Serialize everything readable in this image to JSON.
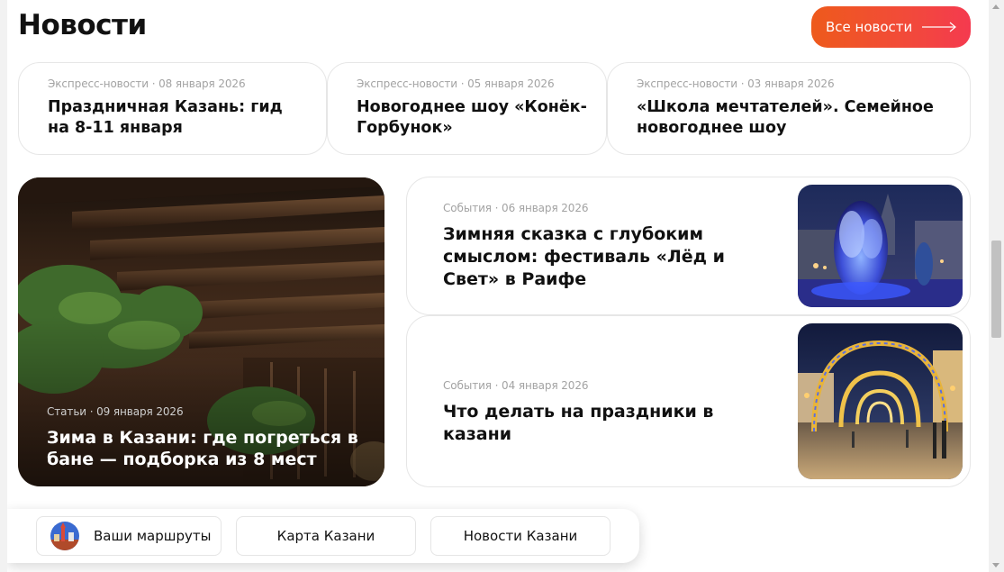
{
  "header": {
    "title": "Новости",
    "all_news_label": "Все новости"
  },
  "express_news": [
    {
      "meta": "Экспресс-новости · 08 января 2026",
      "title": "Праздничная Казань: гид на 8-11 января"
    },
    {
      "meta": "Экспресс-новости · 05 января 2026",
      "title": "Новогоднее шоу «Конёк-Горбунок»"
    },
    {
      "meta": "Экспресс-новости · 03 января 2026",
      "title": "«Школа мечтателей». Семейное новогоднее шоу"
    }
  ],
  "featured_article": {
    "meta": "Статьи · 09 января 2026",
    "title": "Зима в Казани: где погреться в бане — подборка из 8 мест"
  },
  "events": [
    {
      "meta": "События · 06 января 2026",
      "title": "Зимняя сказка с глубоким смыслом: фестиваль «Лёд и Свет» в Раифе"
    },
    {
      "meta": "События · 04 января 2026",
      "title": "Что делать на праздники в казани"
    }
  ],
  "bottom_nav": {
    "routes_label": "Ваши маршруты",
    "map_label": "Карта Казани",
    "news_label": "Новости Казани"
  },
  "colors": {
    "accent_start": "#ee5a1c",
    "accent_end": "#f43a4f",
    "meta_text": "#a3a3a3"
  }
}
